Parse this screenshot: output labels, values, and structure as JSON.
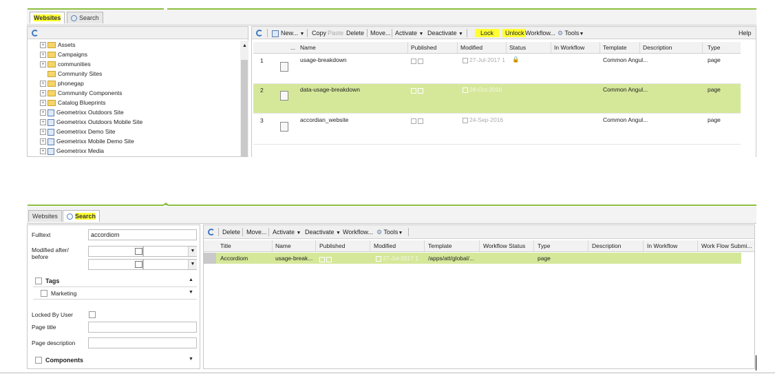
{
  "top": {
    "tabs": [
      {
        "label": "Websites",
        "highlight": true
      },
      {
        "label": "Search"
      }
    ],
    "tree": [
      {
        "label": "Assets",
        "type": "folder"
      },
      {
        "label": "Campaigns",
        "type": "folder"
      },
      {
        "label": "communities",
        "type": "folder"
      },
      {
        "label": "Community Sites",
        "type": "folder-noexp"
      },
      {
        "label": "phonegap",
        "type": "folder"
      },
      {
        "label": "Community Components",
        "type": "folder"
      },
      {
        "label": "Catalog Blueprints",
        "type": "folder"
      },
      {
        "label": "Geometrixx Outdoors Site",
        "type": "page"
      },
      {
        "label": "Geometrixx Outdoors Mobile Site",
        "type": "page"
      },
      {
        "label": "Geometrixx Demo Site",
        "type": "page"
      },
      {
        "label": "Geometrixx Mobile Demo Site",
        "type": "page"
      },
      {
        "label": "Geometrixx Media",
        "type": "page"
      }
    ],
    "toolbar": {
      "new": "New...",
      "copy": "Copy",
      "paste": "Paste",
      "delete": "Delete",
      "move": "Move...",
      "activate": "Activate",
      "deactivate": "Deactivate",
      "lock": "Lock",
      "unlock": "Unlock",
      "workflow": "Workflow...",
      "tools": "Tools",
      "help": "Help"
    },
    "columns": {
      "dots": "...",
      "name": "Name",
      "published": "Published",
      "modified": "Modified",
      "status": "Status",
      "in_workflow": "In Workflow",
      "template": "Template",
      "description": "Description",
      "type": "Type"
    },
    "rows": [
      {
        "num": "1",
        "name": "usage-breakdown",
        "modified": "27-Jul-2017 1",
        "template": "Common Angul...",
        "type": "page"
      },
      {
        "num": "2",
        "name": "data-usage-breakdown",
        "modified": "28-Oct-2016",
        "template": "Common Angul...",
        "type": "page"
      },
      {
        "num": "3",
        "name": "accordian_website",
        "modified": "24-Sep-2016",
        "template": "Common Angul...",
        "type": "page"
      }
    ]
  },
  "bottom": {
    "tabs": [
      {
        "label": "Websites"
      },
      {
        "label": "Search",
        "highlight": true
      }
    ],
    "form": {
      "fulltext_label": "Fulltext",
      "fulltext_value": "accordiom",
      "modified_label_1": "Modified after/",
      "modified_label_2": "before",
      "tags_label": "Tags",
      "marketing_label": "Marketing",
      "locked_label": "Locked By User",
      "page_title_label": "Page title",
      "page_desc_label": "Page description",
      "components_label": "Components"
    },
    "toolbar": {
      "delete": "Delete",
      "move": "Move...",
      "activate": "Activate",
      "deactivate": "Deactivate",
      "workflow": "Workflow...",
      "tools": "Tools"
    },
    "columns": {
      "title": "Title",
      "name": "Name",
      "published": "Published",
      "modified": "Modified",
      "template": "Template",
      "workflow_status": "Workflow Status",
      "type": "Type",
      "description": "Description",
      "in_workflow": "In Workflow",
      "work_flow_submi": "Work Flow Submi..."
    },
    "row": {
      "title": "Accordiom",
      "name": "usage-break...",
      "modified": "27-Jul-2017 1",
      "template": "/apps/att/global/...",
      "type": "page"
    }
  },
  "colors": {
    "selection": "#d5e89a",
    "accent_green": "#8cbf3f",
    "highlight": "#ffff33"
  }
}
